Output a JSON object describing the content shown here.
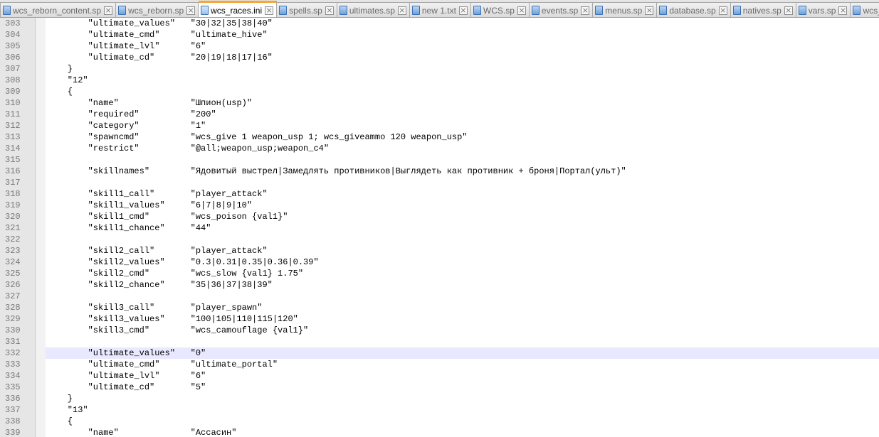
{
  "tabs": [
    {
      "label": "wcs_reborn_content.sp",
      "active": false
    },
    {
      "label": "wcs_reborn.sp",
      "active": false
    },
    {
      "label": "wcs_races.ini",
      "active": true
    },
    {
      "label": "spells.sp",
      "active": false
    },
    {
      "label": "ultimates.sp",
      "active": false
    },
    {
      "label": "new 1.txt",
      "active": false
    },
    {
      "label": "WCS.sp",
      "active": false
    },
    {
      "label": "events.sp",
      "active": false
    },
    {
      "label": "menus.sp",
      "active": false
    },
    {
      "label": "database.sp",
      "active": false
    },
    {
      "label": "natives.sp",
      "active": false
    },
    {
      "label": "vars.sp",
      "active": false
    },
    {
      "label": "wcs_core.inc",
      "active": false
    }
  ],
  "icons": {
    "tab_doc": "document-icon",
    "tab_close": "close-icon",
    "close_glyph": "×"
  },
  "colors": {
    "active_tab_accent": "#f4a63a",
    "current_line": "#e8e8ff",
    "gutter": "#e6e6e6"
  },
  "editor": {
    "current_line": 332,
    "lines": [
      {
        "n": "303",
        "text": "        \"ultimate_values\"   \"30|32|35|38|40\""
      },
      {
        "n": "304",
        "text": "        \"ultimate_cmd\"      \"ultimate_hive\""
      },
      {
        "n": "305",
        "text": "        \"ultimate_lvl\"      \"6\""
      },
      {
        "n": "306",
        "text": "        \"ultimate_cd\"       \"20|19|18|17|16\""
      },
      {
        "n": "307",
        "text": "    }"
      },
      {
        "n": "308",
        "text": "    \"12\""
      },
      {
        "n": "309",
        "text": "    {"
      },
      {
        "n": "310",
        "text": "        \"name\"              \"Шпион(usp)\""
      },
      {
        "n": "311",
        "text": "        \"required\"          \"200\""
      },
      {
        "n": "312",
        "text": "        \"category\"          \"1\""
      },
      {
        "n": "313",
        "text": "        \"spawncmd\"          \"wcs_give 1 weapon_usp 1; wcs_giveammo 120 weapon_usp\""
      },
      {
        "n": "314",
        "text": "        \"restrict\"          \"@all;weapon_usp;weapon_c4\""
      },
      {
        "n": "315",
        "text": ""
      },
      {
        "n": "316",
        "text": "        \"skillnames\"        \"Ядовитый выстрел|Замедлять противников|Выглядеть как противник + броня|Портал(ульт)\""
      },
      {
        "n": "317",
        "text": ""
      },
      {
        "n": "318",
        "text": "        \"skill1_call\"       \"player_attack\""
      },
      {
        "n": "319",
        "text": "        \"skill1_values\"     \"6|7|8|9|10\""
      },
      {
        "n": "320",
        "text": "        \"skill1_cmd\"        \"wcs_poison {val1}\""
      },
      {
        "n": "321",
        "text": "        \"skill1_chance\"     \"44\""
      },
      {
        "n": "322",
        "text": ""
      },
      {
        "n": "323",
        "text": "        \"skill2_call\"       \"player_attack\""
      },
      {
        "n": "324",
        "text": "        \"skill2_values\"     \"0.3|0.31|0.35|0.36|0.39\""
      },
      {
        "n": "325",
        "text": "        \"skill2_cmd\"        \"wcs_slow {val1} 1.75\""
      },
      {
        "n": "326",
        "text": "        \"skill2_chance\"     \"35|36|37|38|39\""
      },
      {
        "n": "327",
        "text": ""
      },
      {
        "n": "328",
        "text": "        \"skill3_call\"       \"player_spawn\""
      },
      {
        "n": "329",
        "text": "        \"skill3_values\"     \"100|105|110|115|120\""
      },
      {
        "n": "330",
        "text": "        \"skill3_cmd\"        \"wcs_camouflage {val1}\""
      },
      {
        "n": "331",
        "text": ""
      },
      {
        "n": "332",
        "text": "        \"ultimate_values\"   \"0\""
      },
      {
        "n": "333",
        "text": "        \"ultimate_cmd\"      \"ultimate_portal\""
      },
      {
        "n": "334",
        "text": "        \"ultimate_lvl\"      \"6\""
      },
      {
        "n": "335",
        "text": "        \"ultimate_cd\"       \"5\""
      },
      {
        "n": "336",
        "text": "    }"
      },
      {
        "n": "337",
        "text": "    \"13\""
      },
      {
        "n": "338",
        "text": "    {"
      },
      {
        "n": "339",
        "text": "        \"name\"              \"Ассасин\""
      }
    ]
  }
}
